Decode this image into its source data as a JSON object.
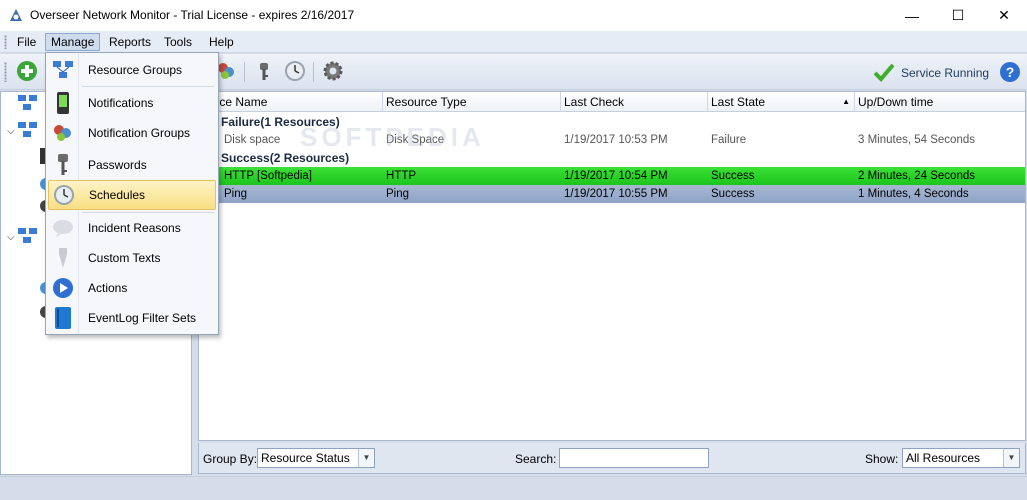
{
  "window": {
    "title": "Overseer Network Monitor - Trial License - expires 2/16/2017",
    "minimize_glyph": "—",
    "maximize_glyph": "☐",
    "close_glyph": "✕"
  },
  "menu": {
    "items": [
      "File",
      "Manage",
      "Reports",
      "Tools",
      "Help"
    ],
    "active": "Manage"
  },
  "toolbar": {
    "buttons": [
      "add-icon",
      "notification-groups-icon",
      "passwords-icon",
      "schedules-icon",
      "settings-icon"
    ],
    "service_status": "Service Running",
    "help_glyph": "?"
  },
  "manage_menu": {
    "items": [
      {
        "label": "Resource Groups",
        "icon": "resource-groups-icon"
      },
      {
        "label": "Notifications",
        "icon": "notifications-icon"
      },
      {
        "label": "Notification Groups",
        "icon": "notification-groups-icon"
      },
      {
        "label": "Passwords",
        "icon": "passwords-icon"
      },
      {
        "label": "Schedules",
        "icon": "schedules-icon",
        "highlighted": true
      },
      {
        "label": "Incident Reasons",
        "icon": "incident-reasons-icon"
      },
      {
        "label": "Custom Texts",
        "icon": "custom-texts-icon"
      },
      {
        "label": "Actions",
        "icon": "actions-icon"
      },
      {
        "label": "EventLog Filter Sets",
        "icon": "eventlog-filter-sets-icon"
      }
    ]
  },
  "grid": {
    "columns": [
      "Resource Name",
      "Resource Type",
      "Last Check",
      "Last State",
      "Up/Down time"
    ],
    "visible_columns": [
      "ource Name",
      "Resource Type",
      "Last Check",
      "Last State",
      "Up/Down time"
    ],
    "sort_column": "Last State",
    "groups": [
      {
        "label": "Failure(1 Resources)",
        "rows": [
          {
            "name": "Disk space",
            "type": "Disk Space",
            "last_check": "1/19/2017 10:53 PM",
            "last_state": "Failure",
            "updown": "3 Minutes, 54 Seconds"
          }
        ]
      },
      {
        "label": "Success(2 Resources)",
        "rows": [
          {
            "name": "HTTP [Softpedia]",
            "type": "HTTP",
            "last_check": "1/19/2017 10:54 PM",
            "last_state": "Success",
            "updown": "2 Minutes, 24 Seconds"
          },
          {
            "name": "Ping",
            "type": "Ping",
            "last_check": "1/19/2017 10:55 PM",
            "last_state": "Success",
            "updown": "1 Minutes, 4 Seconds"
          }
        ]
      }
    ]
  },
  "filterbar": {
    "group_by_label": "Group By:",
    "group_by_value": "Resource Status",
    "search_label": "Search:",
    "search_value": "",
    "show_label": "Show:",
    "show_value": "All Resources"
  },
  "watermark": "SOFTPEDIA",
  "colors": {
    "success_row": "#2bd42a",
    "selected_row": "#9aaccb",
    "menu_highlight": "#f9df84"
  }
}
